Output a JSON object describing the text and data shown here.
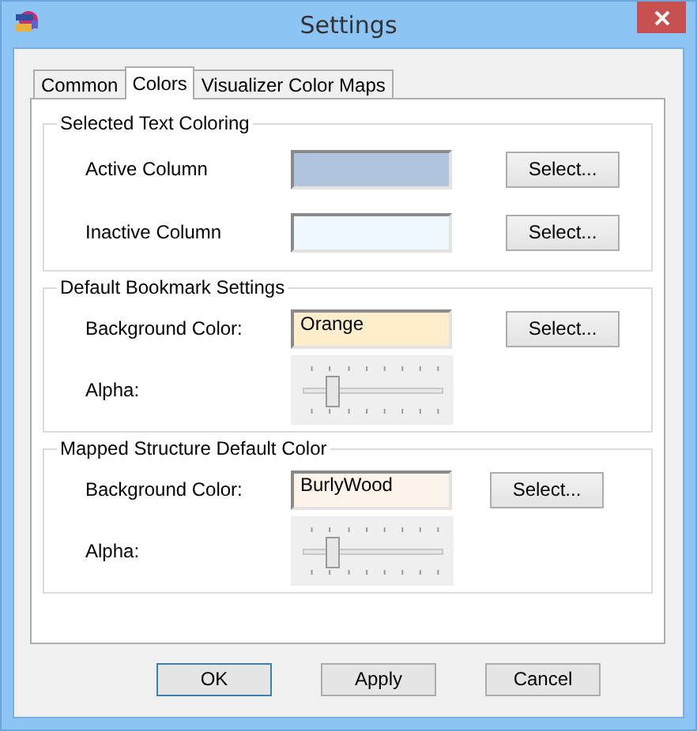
{
  "window": {
    "title": "Settings"
  },
  "tabs": [
    {
      "label": "Common",
      "selected": false
    },
    {
      "label": "Colors",
      "selected": true
    },
    {
      "label": "Visualizer Color Maps",
      "selected": false
    }
  ],
  "groups": [
    {
      "title": "Selected Text Coloring",
      "rows": [
        {
          "kind": "color",
          "label": "Active Column",
          "color": "#b0c4de",
          "button": "Select..."
        },
        {
          "kind": "color",
          "label": "Inactive Column",
          "color": "#f0f8ff",
          "button": "Select..."
        }
      ]
    },
    {
      "title": "Default Bookmark Settings",
      "rows": [
        {
          "kind": "color",
          "label": "Background Color:",
          "color": "#ffedcc",
          "value": "Orange",
          "button": "Select..."
        },
        {
          "kind": "slider",
          "label": "Alpha:",
          "level": 0.2
        }
      ]
    },
    {
      "title": "Mapped Structure Default Color",
      "rows": [
        {
          "kind": "color",
          "label": "Background Color:",
          "color": "#fcf3ea",
          "value": "BurlyWood",
          "button": "Select..."
        },
        {
          "kind": "slider",
          "label": "Alpha:",
          "level": 0.2
        }
      ]
    }
  ],
  "buttons": [
    {
      "label": "OK",
      "default": true
    },
    {
      "label": "Apply",
      "default": false
    },
    {
      "label": "Cancel",
      "default": false
    }
  ]
}
